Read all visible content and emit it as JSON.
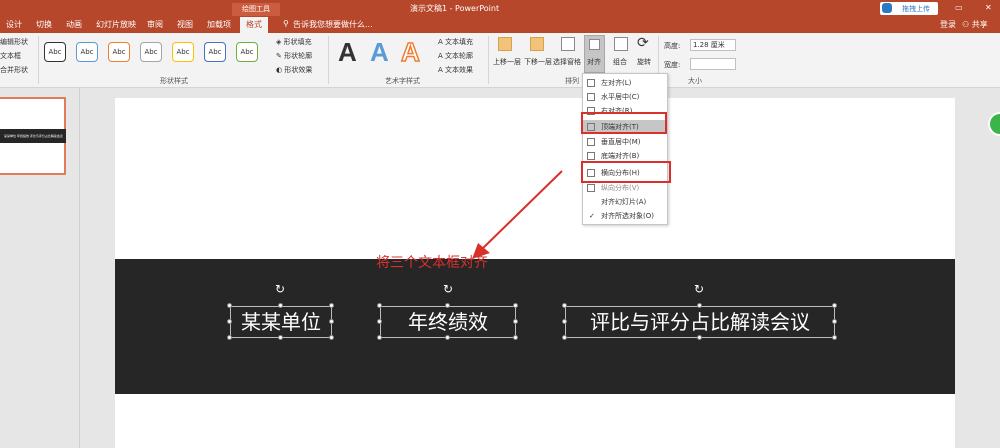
{
  "titlebar": {
    "context_tool": "绘图工具",
    "title": "演示文稿1 - PowerPoint",
    "share_button": "拖拽上传",
    "login": "登录",
    "share": "共享",
    "minimize": "–",
    "restore": "▭",
    "close": "✕"
  },
  "tabs": [
    "设计",
    "切换",
    "动画",
    "幻灯片放映",
    "审阅",
    "视图",
    "加载项",
    "格式"
  ],
  "tell_me": "告诉我您想要做什么...",
  "ribbon": {
    "left_items": [
      "编辑形状",
      "文本框",
      "合并形状"
    ],
    "style_label": "Abc",
    "style_colors": [
      "#333333",
      "#5b9bd5",
      "#ed7d31",
      "#a5a5a5",
      "#ffc000",
      "#4472c4",
      "#70ad47"
    ],
    "shape_fill": "形状填充",
    "shape_outline": "形状轮廓",
    "shape_effects": "形状效果",
    "group_shape_styles": "形状样式",
    "wordart_letter": "A",
    "wordart_colors": [
      "#111111",
      "#5b9bd5",
      "#ed7d31"
    ],
    "text_fill": "文本填充",
    "text_outline": "文本轮廓",
    "text_effects": "文本效果",
    "group_wordart": "艺术字样式",
    "bring_forward": "上移一层",
    "send_backward": "下移一层",
    "selection_pane": "选择窗格",
    "align": "对齐",
    "group": "组合",
    "rotate": "旋转",
    "group_arrange": "排列",
    "height_label": "高度:",
    "height_value": "1.28 厘米",
    "width_label": "宽度:",
    "width_value": "",
    "group_size": "大小"
  },
  "align_menu": [
    {
      "label": "左对齐(L)",
      "checked": false
    },
    {
      "label": "水平居中(C)",
      "checked": false
    },
    {
      "label": "右对齐(R)",
      "checked": false
    },
    {
      "label": "顶端对齐(T)",
      "checked": false
    },
    {
      "label": "垂直居中(M)",
      "checked": false
    },
    {
      "label": "底端对齐(B)",
      "checked": false
    },
    {
      "label": "横向分布(H)",
      "checked": false
    },
    {
      "label": "纵向分布(V)",
      "checked": false
    },
    {
      "label": "对齐幻灯片(A)",
      "checked": false
    },
    {
      "label": "对齐所选对象(O)",
      "checked": true
    }
  ],
  "thumbnail_text": "某某单位 年终绩效 评比与评分占比解读会议",
  "annotation": "将三个文本框对齐",
  "textboxes": [
    "某某单位",
    "年终绩效",
    "评比与评分占比解读会议"
  ],
  "colors": {
    "accent": "#b7472a",
    "highlight_box": "#d9302c",
    "band": "#262626"
  }
}
